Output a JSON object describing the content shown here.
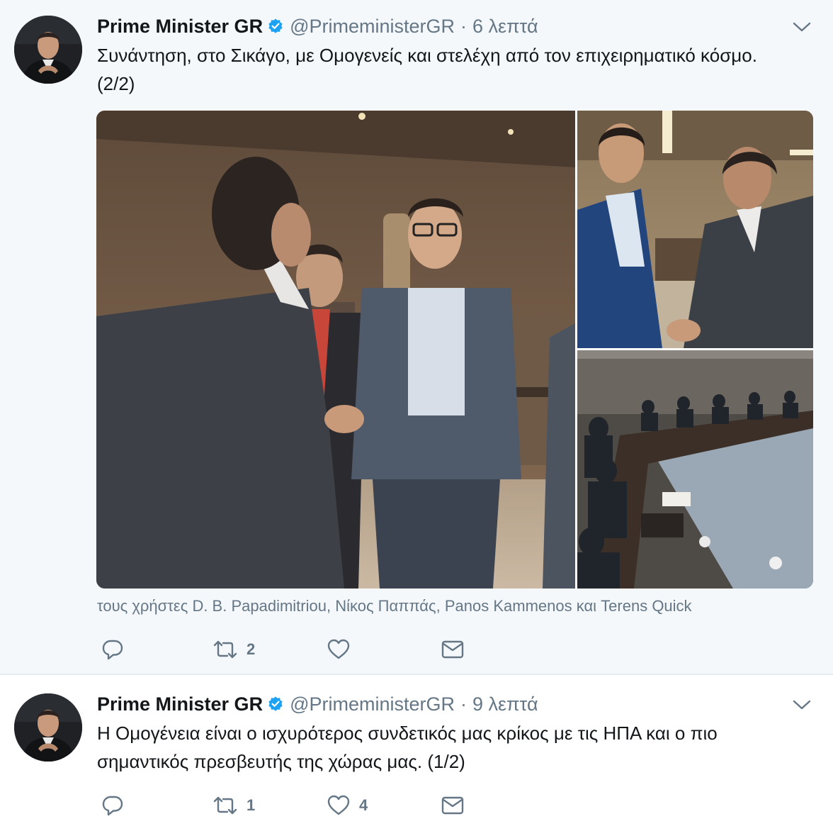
{
  "tweets": [
    {
      "display_name": "Prime Minister GR",
      "handle": "@PrimeministerGR",
      "separator": "·",
      "time": "6 λεπτά",
      "text_line1": "Συνάντηση, στο Σικάγο, με Ομογενείς και στελέχη από τον επιχειρηματικό κόσμο.",
      "text_line2": "(2/2)",
      "tagged": "τους χρήστες D. B. Papadimitriou, Νίκος Παππάς, Panos Kammenos και Terens Quick",
      "retweets": "2",
      "likes": ""
    },
    {
      "display_name": "Prime Minister GR",
      "handle": "@PrimeministerGR",
      "separator": "·",
      "time": "9 λεπτά",
      "text_line1": "Η Ομογένεια είναι ο ισχυρότερος συνδετικός μας κρίκος με τις ΗΠΑ και ο πιο",
      "text_line2": "σημαντικός πρεσβευτής της χώρας μας. (1/2)",
      "retweets": "1",
      "likes": "4"
    }
  ],
  "icons": {
    "verified": "verified-badge-icon",
    "caret": "chevron-down-icon",
    "reply": "reply-icon",
    "retweet": "retweet-icon",
    "like": "heart-icon",
    "message": "envelope-icon"
  },
  "colors": {
    "text": "#14171a",
    "secondary": "#657786",
    "verified": "#1da1f2",
    "highlight_background": "#f5f8fa"
  }
}
